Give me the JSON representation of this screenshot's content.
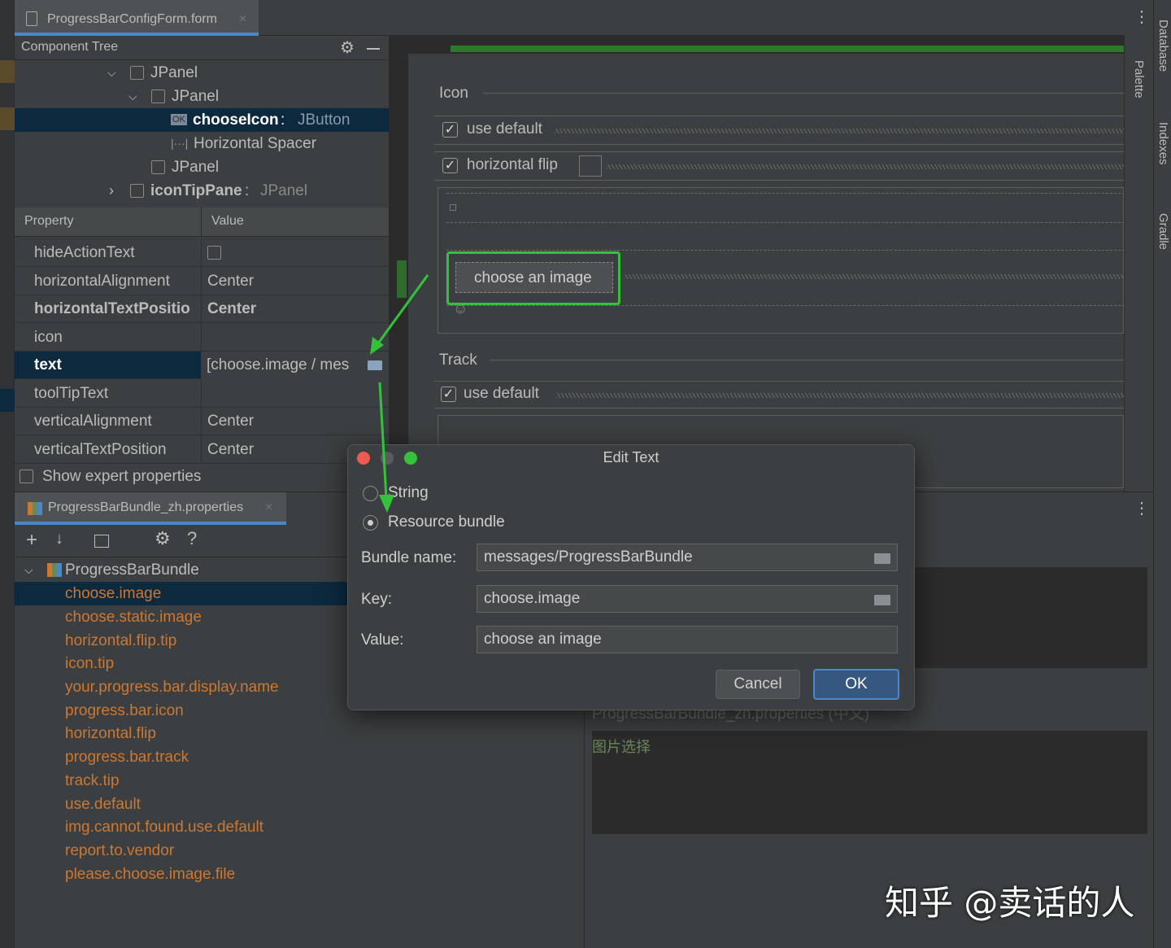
{
  "editor_tab": {
    "title": "ProgressBarConfigForm.form",
    "close": "×"
  },
  "component_tree": {
    "title": "Component Tree",
    "items": [
      {
        "label": "JPanel"
      },
      {
        "label": "JPanel"
      },
      {
        "name": "chooseIcon",
        "sep": " : ",
        "type": "JButton",
        "badge": "OK"
      },
      {
        "label": "Horizontal Spacer"
      },
      {
        "label": "JPanel"
      },
      {
        "name": "iconTipPane",
        "sep": " : ",
        "type": "JPanel"
      }
    ]
  },
  "properties": {
    "headers": {
      "property": "Property",
      "value": "Value"
    },
    "rows": [
      {
        "name": "hideActionText",
        "value": ""
      },
      {
        "name": "horizontalAlignment",
        "value": "Center"
      },
      {
        "name": "horizontalTextPositio",
        "value": "Center"
      },
      {
        "name": "icon",
        "value": ""
      },
      {
        "name": "text",
        "value": "[choose.image / mes"
      },
      {
        "name": "toolTipText",
        "value": ""
      },
      {
        "name": "verticalAlignment",
        "value": "Center"
      },
      {
        "name": "verticalTextPosition",
        "value": "Center"
      }
    ],
    "show_expert": "Show expert properties"
  },
  "bundle_tab": {
    "title": "ProgressBarBundle_zh.properties",
    "close": "×"
  },
  "bundle_toolbar": {
    "add": "+",
    "sort": "↓",
    "help": "?"
  },
  "bundle_tree": {
    "root": "ProgressBarBundle",
    "keys": [
      "choose.image",
      "choose.static.image",
      "horizontal.flip.tip",
      "icon.tip",
      "your.progress.bar.display.name",
      "progress.bar.icon",
      "horizontal.flip",
      "progress.bar.track",
      "track.tip",
      "use.default",
      "img.cannot.found.use.default",
      "report.to.vendor",
      "please.choose.image.file"
    ]
  },
  "designer": {
    "icon_section": "Icon",
    "use_default": "use default",
    "horizontal_flip": "horizontal flip",
    "choose_button": "choose an image",
    "track_section": "Track",
    "use_default_track": "use default"
  },
  "editor_pane": {
    "partial_title": "ProgressBarBundle_zh.properties (中文)",
    "value_text": "图片选择"
  },
  "right_sidebar": {
    "palette": "Palette",
    "database": "Database",
    "indexes": "Indexes",
    "gradle": "Gradle"
  },
  "dialog": {
    "title": "Edit Text",
    "radio_string": "String",
    "radio_bundle": "Resource bundle",
    "bundle_label": "Bundle name:",
    "bundle_value": "messages/ProgressBarBundle",
    "key_label": "Key:",
    "key_value": "choose.image",
    "value_label": "Value:",
    "value_value": "choose an image",
    "cancel": "Cancel",
    "ok": "OK"
  },
  "watermark": "知乎 @卖话的人",
  "colors": {
    "highlight": "#0d293e",
    "orange_key": "#cc7832",
    "accent_green": "#34c23a",
    "ok_blue": "#365880"
  }
}
